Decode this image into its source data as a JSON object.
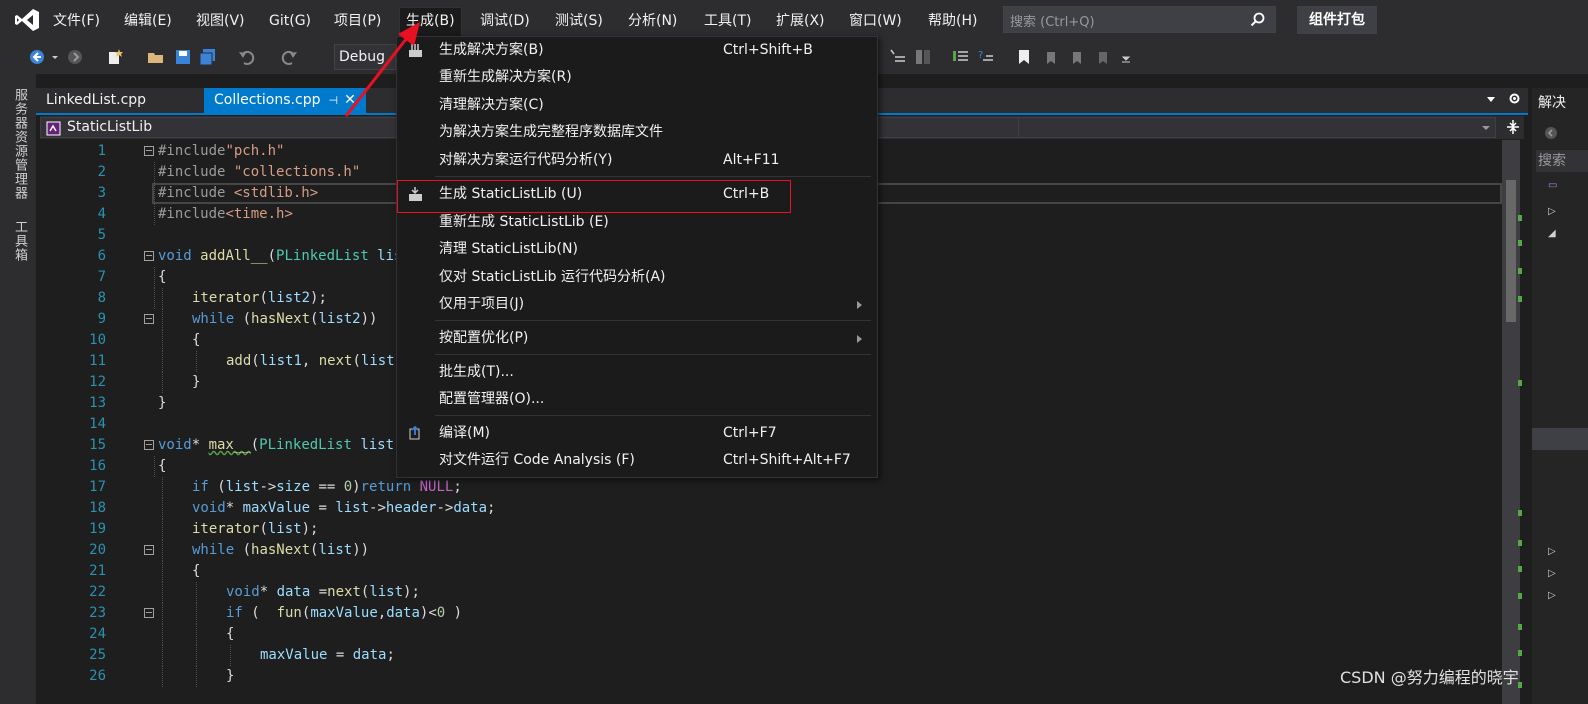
{
  "menubar": {
    "items": [
      "文件(F)",
      "编辑(E)",
      "视图(V)",
      "Git(G)",
      "项目(P)",
      "生成(B)",
      "调试(D)",
      "测试(S)",
      "分析(N)",
      "工具(T)",
      "扩展(X)",
      "窗口(W)",
      "帮助(H)"
    ],
    "search_placeholder": "搜索 (Ctrl+Q)",
    "profile_label": "组件打包"
  },
  "toolbar": {
    "config_label": "Debug"
  },
  "left_rail": {
    "tabs": [
      "服务器资源管理器",
      "工具箱"
    ]
  },
  "tabs": {
    "items": [
      "LinkedList.cpp",
      "Collections.cpp"
    ]
  },
  "navbar": {
    "project": "StaticListLib"
  },
  "right_panel": {
    "title": "解决",
    "search": "搜索"
  },
  "build_menu": {
    "items": [
      {
        "label": "生成解决方案(B)",
        "shortcut": "Ctrl+Shift+B"
      },
      {
        "label": "重新生成解决方案(R)",
        "shortcut": ""
      },
      {
        "label": "清理解决方案(C)",
        "shortcut": ""
      },
      {
        "label": "为解决方案生成完整程序数据库文件",
        "shortcut": ""
      },
      {
        "label": "对解决方案运行代码分析(Y)",
        "shortcut": "Alt+F11"
      },
      {
        "label": "生成 StaticListLib (U)",
        "shortcut": "Ctrl+B"
      },
      {
        "label": "重新生成 StaticListLib (E)",
        "shortcut": ""
      },
      {
        "label": "清理 StaticListLib(N)",
        "shortcut": ""
      },
      {
        "label": "仅对 StaticListLib 运行代码分析(A)",
        "shortcut": ""
      },
      {
        "label": "仅用于项目(J)",
        "shortcut": ""
      },
      {
        "label": "按配置优化(P)",
        "shortcut": ""
      },
      {
        "label": "批生成(T)...",
        "shortcut": ""
      },
      {
        "label": "配置管理器(O)...",
        "shortcut": ""
      },
      {
        "label": "编译(M)",
        "shortcut": "Ctrl+F7"
      },
      {
        "label": "对文件运行 Code Analysis (F)",
        "shortcut": "Ctrl+Shift+Alt+F7"
      }
    ]
  },
  "editor": {
    "line_numbers": [
      "1",
      "2",
      "3",
      "4",
      "5",
      "6",
      "7",
      "8",
      "9",
      "10",
      "11",
      "12",
      "13",
      "14",
      "15",
      "16",
      "17",
      "18",
      "19",
      "20",
      "21",
      "22",
      "23",
      "24",
      "25",
      "26"
    ],
    "lines": [
      [
        "#include",
        "\"pch.h\""
      ],
      [
        "#include ",
        "\"collections.h\""
      ],
      [
        "#include ",
        "<stdlib.h>"
      ],
      [
        "#include",
        "<time.h>"
      ],
      [],
      [
        "void",
        " ",
        "addAll__",
        "(",
        "PLinkedList",
        " lis"
      ],
      [
        "{"
      ],
      [
        "iterator",
        "(",
        "list2",
        ");"
      ],
      [
        "while",
        " (",
        "hasNext",
        "(",
        "list2",
        "))"
      ],
      [
        "{"
      ],
      [
        "add",
        "(",
        "list1",
        ", ",
        "next",
        "(",
        "list"
      ],
      [
        "}"
      ],
      [
        "}"
      ],
      [],
      [
        "void",
        "* ",
        "max__",
        "(",
        "PLinkedList",
        " list"
      ],
      [
        "{"
      ],
      [
        "if",
        " (",
        "list",
        "->",
        "size",
        " == ",
        "0",
        ")",
        "return",
        " ",
        "NULL",
        ";"
      ],
      [
        "void",
        "* ",
        "maxValue",
        " = ",
        "list",
        "->",
        "header",
        "->",
        "data",
        ";"
      ],
      [
        "iterator",
        "(",
        "list",
        ");"
      ],
      [
        "while",
        " (",
        "hasNext",
        "(",
        "list",
        "))"
      ],
      [
        "{"
      ],
      [
        "void",
        "* ",
        "data",
        " =",
        "next",
        "(",
        "list",
        ");"
      ],
      [
        "if",
        " (  ",
        "fun",
        "(",
        "maxValue",
        ",",
        "data",
        ")<",
        "0",
        " )"
      ],
      [
        "{"
      ],
      [
        "maxValue",
        " = ",
        "data",
        ";"
      ],
      [
        "}"
      ]
    ]
  },
  "watermark": "CSDN @努力编程的晓宇",
  "colors": {
    "accent": "#007acc",
    "highlight_box": "#e81123",
    "annotation_arrow": "#e81123"
  }
}
